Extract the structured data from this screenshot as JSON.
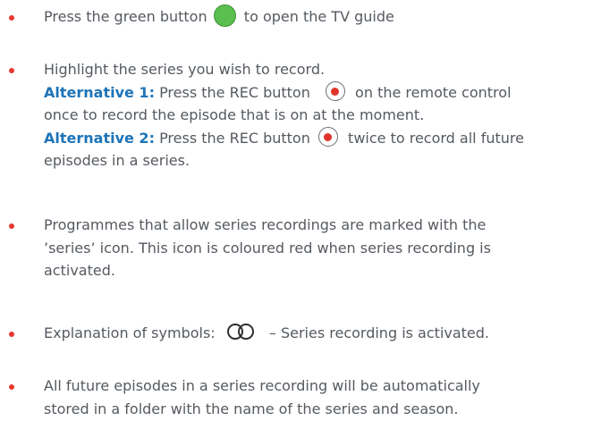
{
  "bullets": {
    "color": "#e8372e"
  },
  "item1": {
    "text_a": "Press the green button",
    "icon": "green-button-icon",
    "text_b": "to open the TV guide"
  },
  "item2": {
    "line1": "Highlight the series you wish to record.",
    "alt1_label": "Alternative 1:",
    "alt1_text_a": "Press the REC button",
    "rec_icon": "rec-button-icon",
    "alt1_text_b": "on the remote control",
    "alt1_line2": "once to record the episode that is on at the moment.",
    "alt2_label": "Alternative 2:",
    "alt2_text_a": "Press the REC button",
    "alt2_text_b": "twice to record all future",
    "alt2_line2": "episodes in a series."
  },
  "item3": {
    "line1": "Programmes that allow series recordings are marked with the",
    "line2": "’series’ icon. This icon is coloured red when series recording is",
    "line3": "activated."
  },
  "item4": {
    "text_a": "Explanation of symbols:",
    "icon": "series-recording-icon",
    "text_b": "– Series recording is activated."
  },
  "item5": {
    "line1": "All future episodes in a series recording will be automatically",
    "line2": "stored in a folder with the name of the series and season."
  },
  "colors": {
    "body_text": "#555a60",
    "highlight_text": "#1d74b8",
    "green_button": "#5bbf50",
    "rec_dot": "#e0342b"
  }
}
